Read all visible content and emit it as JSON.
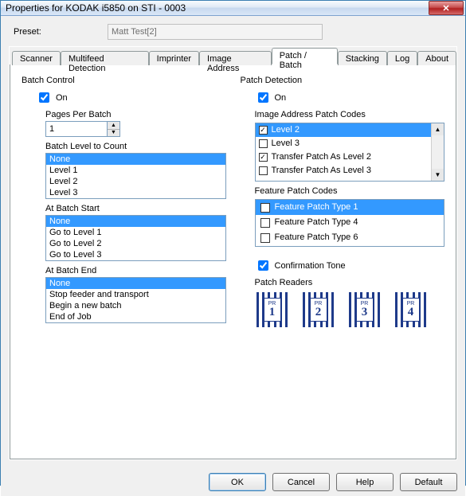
{
  "window": {
    "title": "Properties for KODAK i5850 on STI - 0003"
  },
  "preset": {
    "label": "Preset:",
    "value": "Matt Test[2]"
  },
  "tabs": [
    {
      "label": "Scanner"
    },
    {
      "label": "Multifeed Detection"
    },
    {
      "label": "Imprinter"
    },
    {
      "label": "Image Address"
    },
    {
      "label": "Patch / Batch"
    },
    {
      "label": "Stacking"
    },
    {
      "label": "Log"
    },
    {
      "label": "About"
    }
  ],
  "active_tab_index": 4,
  "batch_control": {
    "heading": "Batch Control",
    "on_label": "On",
    "on_checked": true,
    "pages_label": "Pages Per Batch",
    "pages_value": "1",
    "level_to_count_label": "Batch Level to Count",
    "level_to_count_options": [
      "None",
      "Level 1",
      "Level 2",
      "Level 3"
    ],
    "level_to_count_selected": 0,
    "at_start_label": "At Batch Start",
    "at_start_options": [
      "None",
      "Go to Level 1",
      "Go to Level 2",
      "Go to Level 3"
    ],
    "at_start_selected": 0,
    "at_end_label": "At Batch End",
    "at_end_options": [
      "None",
      "Stop feeder and transport",
      "Begin a new batch",
      "End of Job"
    ],
    "at_end_selected": 0
  },
  "patch_detection": {
    "heading": "Patch Detection",
    "on_label": "On",
    "on_checked": true,
    "addr_codes_label": "Image Address Patch Codes",
    "addr_codes": [
      {
        "label": "Level 2",
        "checked": true
      },
      {
        "label": "Level 3",
        "checked": false
      },
      {
        "label": "Transfer Patch As Level 2",
        "checked": true
      },
      {
        "label": "Transfer Patch As Level 3",
        "checked": false
      }
    ],
    "addr_codes_selected": 0,
    "feature_codes_label": "Feature Patch Codes",
    "feature_codes": [
      {
        "label": "Feature Patch Type 1",
        "checked": false
      },
      {
        "label": "Feature Patch Type 4",
        "checked": false
      },
      {
        "label": "Feature Patch Type 6",
        "checked": false
      }
    ],
    "feature_codes_selected": 0,
    "confirm_label": "Confirmation Tone",
    "confirm_checked": true,
    "readers_label": "Patch Readers",
    "readers_prefix": "PR",
    "readers": [
      "1",
      "2",
      "3",
      "4"
    ]
  },
  "buttons": {
    "ok": "OK",
    "cancel": "Cancel",
    "help": "Help",
    "default": "Default"
  }
}
